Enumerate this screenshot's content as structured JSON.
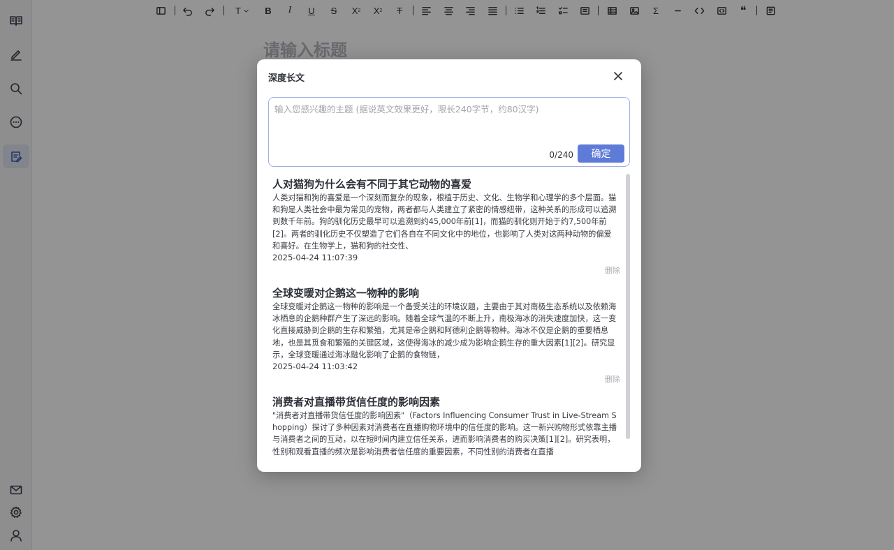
{
  "editor": {
    "title_placeholder": "请输入标题"
  },
  "sidebar": {
    "items": [
      {
        "name": "book-icon"
      },
      {
        "name": "pen-icon"
      },
      {
        "name": "search-icon"
      },
      {
        "name": "chat-icon"
      },
      {
        "name": "article-icon",
        "active": true
      },
      {
        "name": "mail-icon"
      },
      {
        "name": "gear-icon"
      },
      {
        "name": "user-icon"
      }
    ]
  },
  "toolbar": {
    "text_style": "T",
    "bold": "B",
    "italic": "I",
    "underline": "U",
    "strike": "S",
    "superscript_base": "X",
    "superscript_mark": "2",
    "subscript_base": "X",
    "subscript_mark": "2",
    "clear_format": "T",
    "sigma": "Σ",
    "quote": "❝"
  },
  "modal": {
    "title": "深度长文",
    "input_placeholder": "输入您感兴趣的主题 (据说英文效果更好，限长240字节，约80汉字)",
    "input_value": "",
    "counter": "0/240",
    "confirm_label": "确定",
    "articles": [
      {
        "title": "人对猫狗为什么会有不同于其它动物的喜爱",
        "summary": "人类对猫和狗的喜爱是一个深刻而复杂的现象，根植于历史、文化、生物学和心理学的多个层面。猫和狗是人类社会中最为常见的宠物，两者都与人类建立了紧密的情感纽带，这种关系的形成可以追溯到数千年前。狗的驯化历史最早可以追溯到约45,000年前[1]，而猫的驯化则开始于约7,500年前[2]。两者的驯化历史不仅塑造了它们各自在不同文化中的地位，也影响了人类对这两种动物的偏爱和喜好。在生物学上，猫和狗的社交性、",
        "time": "2025-04-24 11:07:39",
        "delete_label": "删除"
      },
      {
        "title": "全球变暖对企鹅这一物种的影响",
        "summary": "全球变暖对企鹅这一物种的影响是一个备受关注的环境议题，主要由于其对南极生态系统以及依赖海冰栖息的企鹅种群产生了深远的影响。随着全球气温的不断上升，南极海冰的消失速度加快，这一变化直接威胁到企鹅的生存和繁殖，尤其是帝企鹅和阿德利企鹅等物种。海冰不仅是企鹅的重要栖息地，也是其觅食和繁殖的关键区域，这使得海冰的减少成为影响企鹅生存的重大因素[1][2]。研究显示，全球变暖通过海冰融化影响了企鹅的食物链，",
        "time": "2025-04-24 11:03:42",
        "delete_label": "删除"
      },
      {
        "title": "消费者对直播带货信任度的影响因素",
        "summary": "\"消费者对直播带货信任度的影响因素\"（Factors Influencing Consumer Trust in Live-Stream Shopping）探讨了多种因素对消费者在直播购物环境中的信任度的影响。这一新兴购物形式依靠主播与消费者之间的互动，以在短时间内建立信任关系，进而影响消费者的购买决策[1][2]。研究表明，性别和观看直播的频次是影响消费者信任度的重要因素，不同性别的消费者在直播",
        "time": "",
        "delete_label": ""
      }
    ]
  }
}
